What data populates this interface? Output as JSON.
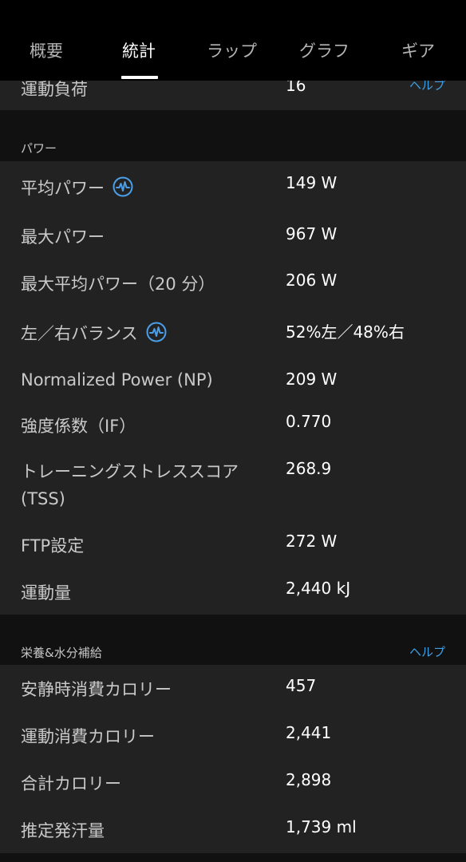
{
  "tabs": [
    {
      "label": "概要"
    },
    {
      "label": "統計"
    },
    {
      "label": "ラップ"
    },
    {
      "label": "グラフ"
    },
    {
      "label": "ギア"
    }
  ],
  "active_tab_index": 1,
  "training_load_row": {
    "label": "運動負荷",
    "value": "16",
    "help_label": "ヘルプ"
  },
  "power": {
    "title": "パワー",
    "rows": [
      {
        "label": "平均パワー",
        "value": "149 W",
        "icon": "power-wave-icon"
      },
      {
        "label": "最大パワー",
        "value": "967 W"
      },
      {
        "label": "最大平均パワー（20 分）",
        "value": "206 W"
      },
      {
        "label": "左／右バランス",
        "value": "52%左／48%右",
        "icon": "power-wave-icon"
      },
      {
        "label": "Normalized Power (NP)",
        "value": "209 W"
      },
      {
        "label": "強度係数（IF）",
        "value": "0.770"
      },
      {
        "label": "トレーニングストレススコア (TSS)",
        "value": "268.9"
      },
      {
        "label": "FTP設定",
        "value": "272 W"
      },
      {
        "label": "運動量",
        "value": "2,440 kJ"
      }
    ]
  },
  "nutrition": {
    "title": "栄養&水分補給",
    "help_label": "ヘルプ",
    "rows": [
      {
        "label": "安静時消費カロリー",
        "value": "457"
      },
      {
        "label": "運動消費カロリー",
        "value": "2,441"
      },
      {
        "label": "合計カロリー",
        "value": "2,898"
      },
      {
        "label": "推定発汗量",
        "value": "1,739 ml"
      }
    ]
  },
  "colors": {
    "accent_link": "#3f9fe6",
    "icon_accent": "#4a9fe8",
    "row_background": "#222222",
    "header_background": "#111111",
    "tabbar_background": "#000000"
  }
}
